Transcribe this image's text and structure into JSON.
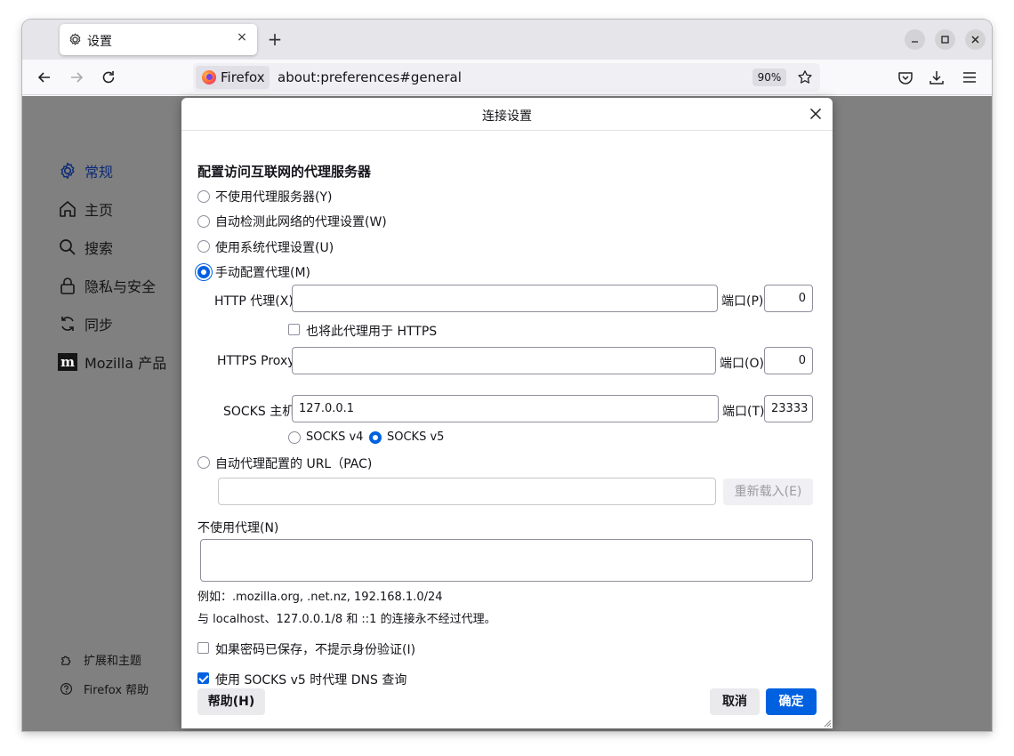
{
  "tab": {
    "title": "设置",
    "close_glyph": "×",
    "new_tab_glyph": "+"
  },
  "urlbar": {
    "identity_label": "Firefox",
    "url": "about:preferences#general",
    "zoom": "90%"
  },
  "sidebar": {
    "items": [
      {
        "label": "常规",
        "icon": "gear-icon",
        "active": true
      },
      {
        "label": "主页",
        "icon": "home-icon"
      },
      {
        "label": "搜索",
        "icon": "search-icon"
      },
      {
        "label": "隐私与安全",
        "icon": "lock-icon"
      },
      {
        "label": "同步",
        "icon": "sync-icon"
      },
      {
        "label": "Mozilla 产品",
        "icon": "mozilla-icon"
      }
    ],
    "bottom": [
      {
        "label": "扩展和主题",
        "icon": "puzzle-icon"
      },
      {
        "label": "Firefox 帮助",
        "icon": "help-icon"
      }
    ]
  },
  "dialog": {
    "title": "连接设置",
    "heading": "配置访问互联网的代理服务器",
    "options": {
      "no_proxy": "不使用代理服务器(Y)",
      "auto_detect": "自动检测此网络的代理设置(W)",
      "system": "使用系统代理设置(U)",
      "manual": "手动配置代理(M)",
      "auto_url": "自动代理配置的 URL（PAC)"
    },
    "http": {
      "label": "HTTP 代理(X)",
      "value": "",
      "port_label": "端口(P)",
      "port": "0"
    },
    "also_https": "也将此代理用于 HTTPS",
    "https": {
      "label": "HTTPS Proxy",
      "value": "",
      "port_label": "端口(O)",
      "port": "0"
    },
    "socks": {
      "label": "SOCKS 主机",
      "value": "127.0.0.1",
      "port_label": "端口(T)",
      "port": "23333"
    },
    "socks_v4": "SOCKS v4",
    "socks_v5": "SOCKS v5",
    "pac_value": "",
    "reload_button": "重新载入(E)",
    "no_proxy_for_label": "不使用代理(N)",
    "no_proxy_for_value": "",
    "example": "例如：.mozilla.org, .net.nz, 192.168.1.0/24",
    "localhost_note": "与 localhost、127.0.0.1/8 和 ::1 的连接永不经过代理。",
    "no_auth_prompt": "如果密码已保存，不提示身份验证(I)",
    "socks_dns": "使用 SOCKS v5 时代理 DNS 查询",
    "help_button": "帮助(H)",
    "cancel_button": "取消",
    "ok_button": "确定"
  },
  "colors": {
    "accent": "#0061e0",
    "backdrop": "#808080"
  }
}
